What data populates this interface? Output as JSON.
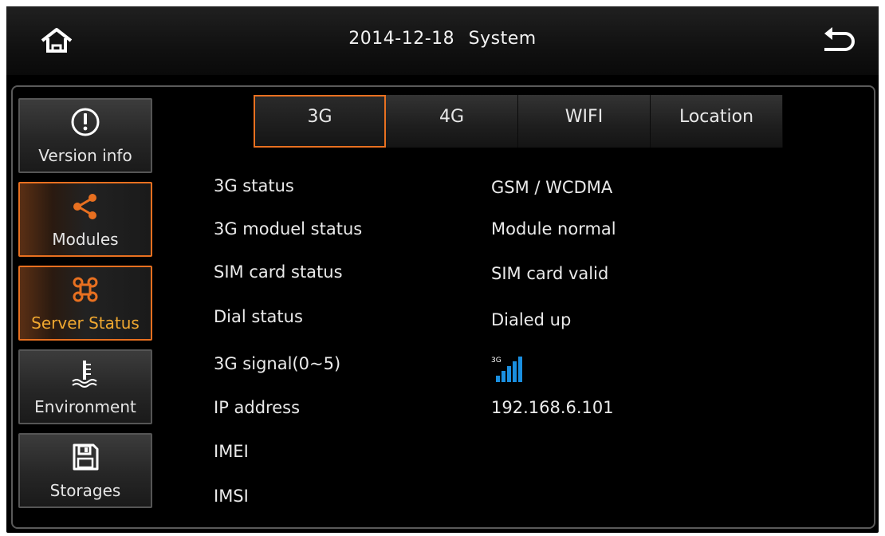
{
  "header": {
    "date": "2014-12-18",
    "title": "System",
    "home_icon": "home-icon",
    "back_icon": "back-arrow-icon"
  },
  "sidebar": {
    "items": [
      {
        "label": "Version info",
        "icon": "info-icon",
        "active": false
      },
      {
        "label": "Modules",
        "icon": "share-icon",
        "active": true
      },
      {
        "label": "Server Status",
        "icon": "network-icon",
        "active": true
      },
      {
        "label": "Environment",
        "icon": "thermometer-icon",
        "active": false
      },
      {
        "label": "Storages",
        "icon": "save-icon",
        "active": false
      }
    ]
  },
  "tabs": [
    {
      "label": "3G",
      "active": true
    },
    {
      "label": "4G",
      "active": false
    },
    {
      "label": "WIFI",
      "active": false
    },
    {
      "label": "Location",
      "active": false
    }
  ],
  "status": {
    "rows": [
      {
        "label": "3G status",
        "value": "GSM / WCDMA"
      },
      {
        "label": "3G moduel status",
        "value": "Module normal"
      },
      {
        "label": "SIM card status",
        "value": "SIM card valid"
      },
      {
        "label": "Dial status",
        "value": "Dialed up"
      },
      {
        "label": "3G signal(0~5)",
        "value": ""
      },
      {
        "label": "IP address",
        "value": "192.168.6.101"
      },
      {
        "label": "IMEI",
        "value": ""
      },
      {
        "label": "IMSI",
        "value": ""
      }
    ],
    "signal": {
      "badge": "3G",
      "level": 5,
      "max": 5
    }
  },
  "colors": {
    "accent": "#e87020",
    "server_status_label": "#f0a830",
    "signal_blue": "#1a8fe0"
  }
}
